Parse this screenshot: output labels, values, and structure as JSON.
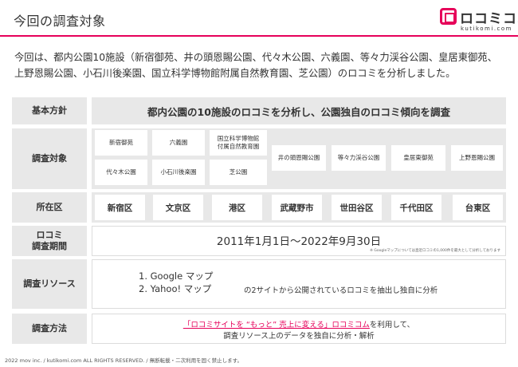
{
  "header": {
    "title": "今回の調査対象"
  },
  "logo": {
    "text": "ロコミコム",
    "sub": "kutikomi.com"
  },
  "intro": "今回は、都内公園10施設（新宿御苑、井の頭恩賜公園、代々木公園、六義園、等々力渓谷公園、皇居東御苑、上野恩賜公園、小石川後楽園、国立科学博物館附属自然教育園、芝公園）のロコミを分析しました。",
  "rows": {
    "policy": {
      "label": "基本方針",
      "text": "都内公園の10施設のロコミを分析し、公園独自のロコミ傾向を調査"
    },
    "targets": {
      "label": "調査対象",
      "parks": [
        "新宿御苑",
        "六義園",
        "国立科学博物館\n付属自然教育園",
        "代々木公園",
        "小石川後楽園",
        "芝公園",
        "井の頭恩賜公園",
        "等々力渓谷公園",
        "皇居東御苑",
        "上野恩賜公園"
      ]
    },
    "location": {
      "label": "所在区",
      "wards": [
        "新宿区",
        "文京区",
        "港区",
        "武蔵野市",
        "世田谷区",
        "千代田区",
        "台東区"
      ]
    },
    "period": {
      "label": "ロコミ\n調査期間",
      "text": "2011年1月1日〜2022年9月30日",
      "note": "※ Googleマップについては直近ロコミの1,000件を最大として分析しております"
    },
    "resources": {
      "label": "調査リソース",
      "items": [
        "1.  Google マップ",
        "2.  Yahoo! マップ"
      ],
      "note": "の2サイトから公開されているロコミを抽出し独自に分析"
    },
    "method": {
      "label": "調査方法",
      "highlight": "「ロコミサイトを “もっと” 売上に変える」ロコミコム",
      "line1_rest": "を利用して、",
      "line2": "調査リソース上のデータを独自に分析・解析"
    }
  },
  "footer": "2022 mov inc. / kutikomi.com ALL RIGHTS RESERVED. / 無断転載・二次利用を固く禁止します。"
}
